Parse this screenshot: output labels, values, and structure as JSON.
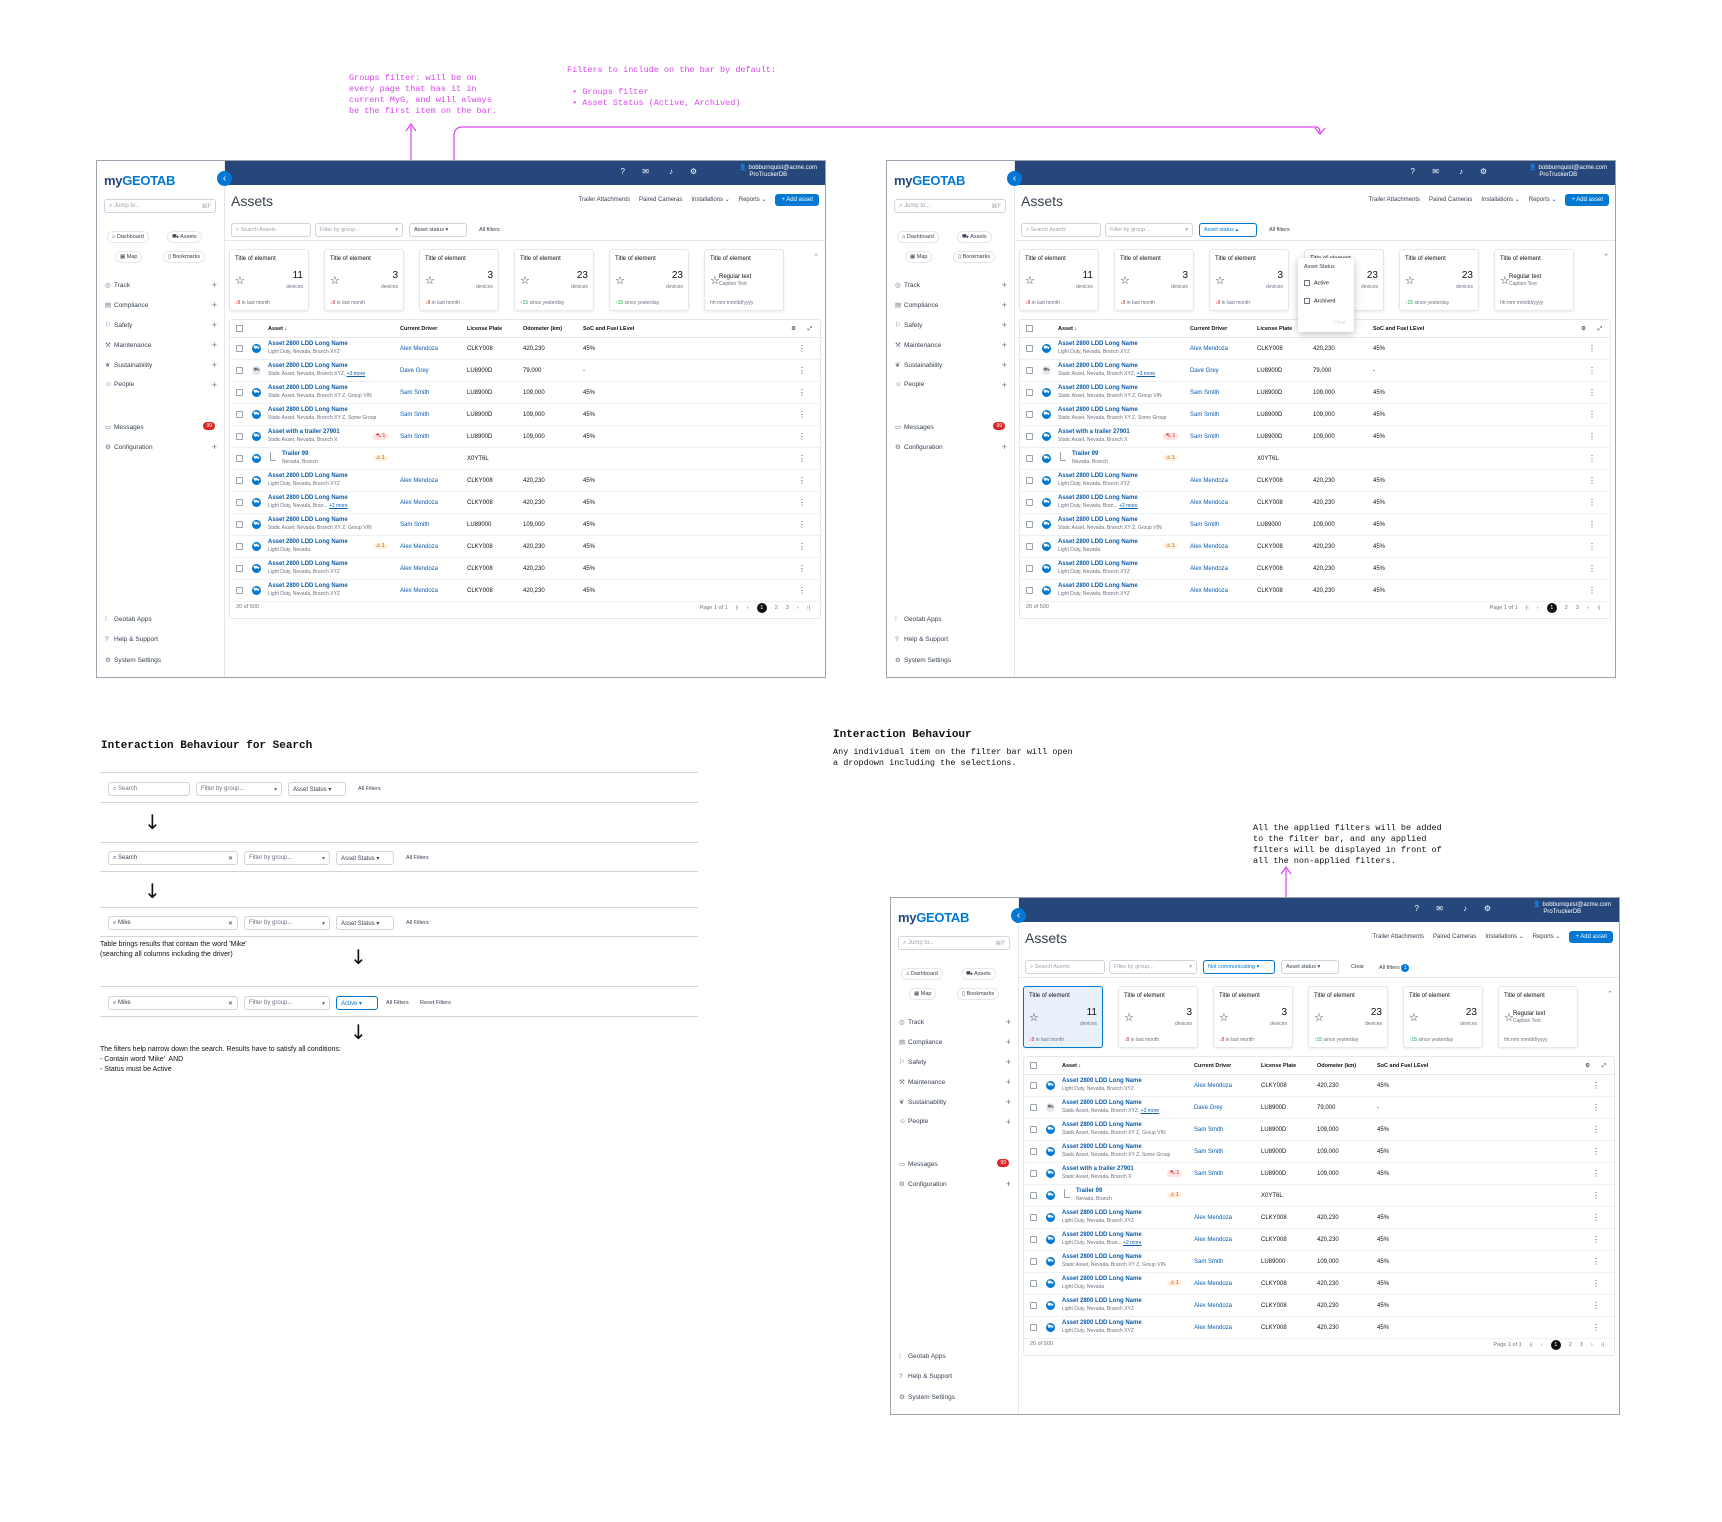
{
  "annotations": {
    "groups_filter": "Groups filter: will be on\nevery page that has it in\ncurrent MyG, and will always\nbe the first item on the bar.",
    "default_filters": "Filters to include on the bar by default:\n\n • Groups filter\n • Asset Status (Active, Archived)",
    "search_heading": "Interaction Behaviour for Search",
    "interaction_heading": "Interaction Behaviour",
    "interaction_text": "Any individual item on the filter bar will open\na dropdown including the selections.",
    "applied_text": "All the applied filters will be added\nto the filter bar, and any applied\nfilters will be displayed in front of\nall the non-applied filters."
  },
  "app": {
    "logo_a": "my",
    "logo_b": "GEOTAB",
    "user_email": "bobburnquist@acme.com",
    "user_db": "ProTruckerDB",
    "jump_placeholder": "Jump to...",
    "jump_shortcut": "⌘F",
    "quick": [
      "Dashboard",
      "Assets",
      "Map",
      "Bookmarks"
    ],
    "nav": [
      "Track",
      "Compliance",
      "Safety",
      "Maintenance",
      "Sustainability",
      "People"
    ],
    "messages": "Messages",
    "messages_count": "99",
    "configuration": "Configuration",
    "bottom_nav": [
      "Geotab Apps",
      "Help & Support",
      "System Settings"
    ],
    "page_title": "Assets",
    "header_links": [
      "Trailer Attachments",
      "Paired Cameras",
      "Installations ⌄",
      "Reports ⌄"
    ],
    "add_asset": "+ Add asset",
    "search_placeholder": "Search Assets",
    "group_placeholder": "Filter by group...",
    "asset_status": "Asset status",
    "all_filters": "All filters",
    "not_communicating": "Not communicating",
    "clear": "Clear",
    "all_filters_count": "1",
    "dropdown": {
      "header": "Asset Status",
      "options": [
        "Active",
        "Archived"
      ],
      "clear": "Clear"
    }
  },
  "cards": [
    {
      "title": "Title of element",
      "value": "11",
      "unit": "devices",
      "delta": "↓8",
      "period": "in last month",
      "up": false
    },
    {
      "title": "Title of element",
      "value": "3",
      "unit": "devices",
      "delta": "↓8",
      "period": "in last month",
      "up": false
    },
    {
      "title": "Title of element",
      "value": "3",
      "unit": "devices",
      "delta": "↓8",
      "period": "in last month",
      "up": false
    },
    {
      "title": "Title of element",
      "value": "23",
      "unit": "devices",
      "delta": "↑15",
      "period": "since yesterday",
      "up": true
    },
    {
      "title": "Title of element",
      "value": "23",
      "unit": "devices",
      "delta": "↑15",
      "period": "since yesterday",
      "up": true
    },
    {
      "title": "Title of element",
      "regular": "Regular text",
      "caption": "Caption Text",
      "date": "hh:mm mm/dd/yyyy"
    }
  ],
  "table": {
    "headers": [
      "Asset ↓",
      "Current Driver",
      "License Plate",
      "Odometer (km)",
      "SoC and Fuel LEvel"
    ],
    "rows": [
      {
        "name": "Asset 2800 LDD Long Name",
        "sub": "Light Duty, Nevada, Branch XYZ",
        "driver": "Alex Mendoza",
        "plate": "CLKY008",
        "odo": "420,230",
        "soc": "45%"
      },
      {
        "name": "Asset 2800 LDD Long Name",
        "sub": "Static Asset, Nevada, Branch XYZ,",
        "more": "+3 more",
        "driver": "Dave Grey",
        "plate": "LU8900D",
        "odo": "79,000",
        "soc": "-",
        "grey": true
      },
      {
        "name": "Asset 2800 LDD Long Name",
        "sub": "Static Asset, Nevada, Branch XY Z, Group VIN",
        "driver": "Sam Smith",
        "plate": "LU8900D",
        "odo": "109,000",
        "soc": "45%"
      },
      {
        "name": "Asset 2800 LDD Long Name",
        "sub": "Static Asset, Nevada, Branch XY Z, Some Group",
        "driver": "Sam Smith",
        "plate": "LU8900D",
        "odo": "109,000",
        "soc": "45%"
      },
      {
        "name": "Asset with a trailer 27901",
        "sub": "Static Asset, Nevada, Branch X",
        "tag": "⛍ 1",
        "tagc": "red",
        "driver": "Sam Smith",
        "plate": "LU8900D",
        "odo": "109,000",
        "soc": "45%"
      },
      {
        "name": "Trailer 99",
        "sub": "Nevada, Branch",
        "tag": "⚠ 1",
        "tagc": "orange",
        "driver": "",
        "plate": "X0YT6L",
        "odo": "",
        "soc": "",
        "child": true
      },
      {
        "name": "Asset 2800 LDD Long Name",
        "sub": "Light Duty, Nevada, Branch XYZ",
        "driver": "Alex Mendoza",
        "plate": "CLKY008",
        "odo": "420,230",
        "soc": "45%"
      },
      {
        "name": "Asset 2800 LDD Long Name",
        "sub": "Light Duty, Nevada, Bran...",
        "more": "+2 more",
        "driver": "Alex Mendoza",
        "plate": "CLKY008",
        "odo": "420,230",
        "soc": "45%"
      },
      {
        "name": "Asset 2800 LDD Long Name",
        "sub": "Static Asset, Nevada, Branch XY Z, Group VIN",
        "driver": "Sam Smith",
        "plate": "LU89000",
        "odo": "109,000",
        "soc": "45%"
      },
      {
        "name": "Asset 2800 LDD Long Name",
        "sub": "Light Duty, Nevada",
        "tag": "⚠ 1",
        "tagc": "orange",
        "driver": "Alex Mendoza",
        "plate": "CLKY008",
        "odo": "420,230",
        "soc": "45%"
      },
      {
        "name": "Asset 2800 LDD Long Name",
        "sub": "Light Duty, Nevada, Branch XYZ",
        "driver": "Alex Mendoza",
        "plate": "CLKY008",
        "odo": "420,230",
        "soc": "45%"
      },
      {
        "name": "Asset 2800 LDD Long Name",
        "sub": "Light Duty, Nevada, Branch XYZ",
        "driver": "Alex Mendoza",
        "plate": "CLKY008",
        "odo": "420,230",
        "soc": "45%"
      }
    ],
    "count": "20 of 500",
    "page_label": "Page 1 of 1",
    "pages": [
      "1",
      "2",
      "3"
    ]
  },
  "flow": {
    "search": "Search",
    "group": "Filter by group...",
    "asset_status": "Asset Status",
    "all_filters": "All Filters",
    "mike": "Mike",
    "active": "Active",
    "reset": "Reset Filters",
    "result_text": "Table brings results that contain the word 'Mike'\n(searching all columns including the driver)",
    "final_text": "The filters help narrow down the search. Results have to satisfy all conditions:\n- Contain word 'Mike'  AND\n- Status must be Active"
  }
}
